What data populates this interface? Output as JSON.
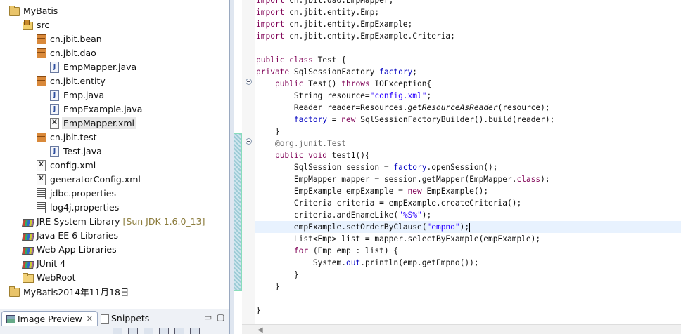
{
  "explorer": {
    "items": [
      {
        "label": "MyBatis",
        "icon": "project-icon",
        "indent": 0
      },
      {
        "label": "src",
        "icon": "source-folder-icon",
        "indent": 1
      },
      {
        "label": "cn.jbit.bean",
        "icon": "package-icon",
        "indent": 2
      },
      {
        "label": "cn.jbit.dao",
        "icon": "package-icon",
        "indent": 2
      },
      {
        "label": "EmpMapper.java",
        "icon": "java-file-icon",
        "indent": 3
      },
      {
        "label": "cn.jbit.entity",
        "icon": "package-icon",
        "indent": 2
      },
      {
        "label": "Emp.java",
        "icon": "java-file-icon",
        "indent": 3
      },
      {
        "label": "EmpExample.java",
        "icon": "java-file-icon",
        "indent": 3
      },
      {
        "label": "EmpMapper.xml",
        "icon": "xml-file-icon",
        "indent": 3,
        "selected": true
      },
      {
        "label": "cn.jbit.test",
        "icon": "package-icon",
        "indent": 2
      },
      {
        "label": "Test.java",
        "icon": "java-file-icon",
        "indent": 3
      },
      {
        "label": "config.xml",
        "icon": "xml-file-icon",
        "indent": 2
      },
      {
        "label": "generatorConfig.xml",
        "icon": "xml-file-icon",
        "indent": 2
      },
      {
        "label": "jdbc.properties",
        "icon": "properties-file-icon",
        "indent": 2
      },
      {
        "label": "log4j.properties",
        "icon": "properties-file-icon",
        "indent": 2
      },
      {
        "label": "JRE System Library",
        "decoration": "[Sun JDK 1.6.0_13]",
        "icon": "library-icon",
        "indent": 1
      },
      {
        "label": "Java EE 6 Libraries",
        "icon": "library-icon",
        "indent": 1
      },
      {
        "label": "Web App Libraries",
        "icon": "library-icon",
        "indent": 1
      },
      {
        "label": "JUnit 4",
        "icon": "library-icon",
        "indent": 1
      },
      {
        "label": "WebRoot",
        "icon": "folder-icon",
        "indent": 1
      },
      {
        "label": "MyBatis2014年11月18日",
        "icon": "project-icon",
        "indent": 0
      }
    ]
  },
  "bottom_tabs": {
    "image_preview": "Image Preview",
    "image_preview_close": "✕",
    "snippets": "Snippets",
    "minimize": "▭",
    "maximize": "▢"
  },
  "editor": {
    "lines": [
      [
        [
          "kw",
          "import "
        ],
        [
          "",
          "cn.jbit.dao.EmpMapper;"
        ]
      ],
      [
        [
          "kw",
          "import "
        ],
        [
          "",
          "cn.jbit.entity.Emp;"
        ]
      ],
      [
        [
          "kw",
          "import "
        ],
        [
          "",
          "cn.jbit.entity.EmpExample;"
        ]
      ],
      [
        [
          "kw",
          "import "
        ],
        [
          "",
          "cn.jbit.entity.EmpExample.Criteria;"
        ]
      ],
      [],
      [
        [
          "kw",
          "public class "
        ],
        [
          "",
          "Test {"
        ]
      ],
      [
        [
          "kw",
          "private "
        ],
        [
          "",
          "SqlSessionFactory "
        ],
        [
          "fld",
          "factory"
        ],
        [
          "",
          ";"
        ]
      ],
      [
        [
          "",
          "    "
        ],
        [
          "kw",
          "public "
        ],
        [
          "",
          "Test() "
        ],
        [
          "kw",
          "throws "
        ],
        [
          "",
          "IOException{"
        ]
      ],
      [
        [
          "",
          "        String resource="
        ],
        [
          "str",
          "\"config.xml\""
        ],
        [
          "",
          ";"
        ]
      ],
      [
        [
          "",
          "        Reader reader=Resources."
        ],
        [
          "ital",
          "getResourceAsReader"
        ],
        [
          "",
          "(resource);"
        ]
      ],
      [
        [
          "",
          "        "
        ],
        [
          "fld",
          "factory"
        ],
        [
          "",
          " = "
        ],
        [
          "kw",
          "new "
        ],
        [
          "",
          "SqlSessionFactoryBuilder().build(reader);"
        ]
      ],
      [
        [
          "",
          "    }"
        ]
      ],
      [
        [
          "",
          "    "
        ],
        [
          "ann",
          "@org.junit.Test"
        ]
      ],
      [
        [
          "",
          "    "
        ],
        [
          "kw",
          "public void "
        ],
        [
          "",
          "test1(){"
        ]
      ],
      [
        [
          "",
          "        SqlSession session = "
        ],
        [
          "fld",
          "factory"
        ],
        [
          "",
          ".openSession();"
        ]
      ],
      [
        [
          "",
          "        EmpMapper mapper = session.getMapper(EmpMapper."
        ],
        [
          "kw",
          "class"
        ],
        [
          "",
          ");"
        ]
      ],
      [
        [
          "",
          "        EmpExample empExample = "
        ],
        [
          "kw",
          "new "
        ],
        [
          "",
          "EmpExample();"
        ]
      ],
      [
        [
          "",
          "        Criteria criteria = empExample.createCriteria();"
        ]
      ],
      [
        [
          "",
          "        criteria.andEnameLike("
        ],
        [
          "str",
          "\"%S%\""
        ],
        [
          "",
          ");"
        ]
      ],
      [
        [
          "",
          "        empExample.setOrderByClause("
        ],
        [
          "str",
          "\"empno\""
        ],
        [
          "",
          ");"
        ],
        [
          "caret",
          ""
        ]
      ],
      [
        [
          "",
          "        List<Emp> list = mapper.selectByExample(empExample);"
        ]
      ],
      [
        [
          "",
          "        "
        ],
        [
          "kw",
          "for "
        ],
        [
          "",
          "(Emp emp : list) {"
        ]
      ],
      [
        [
          "",
          "            System."
        ],
        [
          "fld",
          "out"
        ],
        [
          "",
          ".println(emp.getEmpno());"
        ]
      ],
      [
        [
          "",
          "        }"
        ]
      ],
      [
        [
          "",
          "    }"
        ]
      ],
      [],
      [
        [
          "",
          "}"
        ]
      ]
    ],
    "current_line": 19
  },
  "colors": {
    "keyword": "#7f0055",
    "string": "#2a00ff",
    "field": "#0000c0",
    "annotation": "#646464",
    "current_line_bg": "#e8f2fe"
  }
}
